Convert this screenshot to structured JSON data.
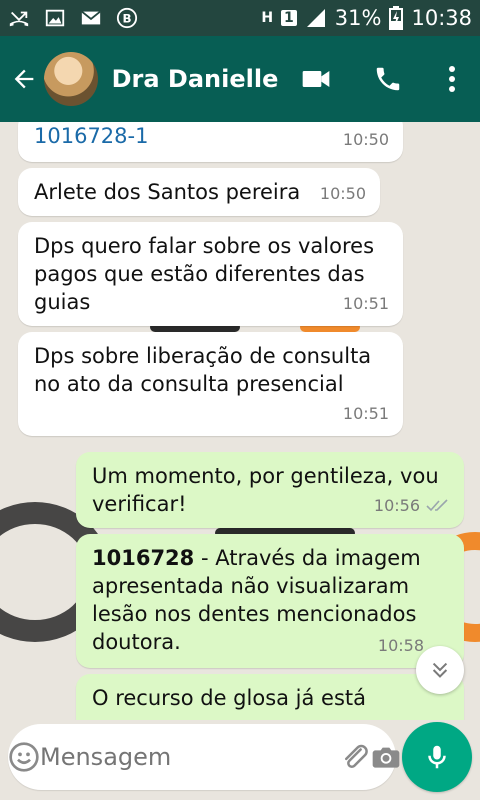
{
  "status_bar": {
    "network": "H",
    "sim": "1",
    "battery": "31%",
    "time": "10:38"
  },
  "header": {
    "contact_name": "Dra Danielle…",
    "icons": [
      "back-arrow-icon",
      "video-call-icon",
      "phone-call-icon",
      "more-options-icon"
    ]
  },
  "messages": [
    {
      "direction": "incoming",
      "text": "1016728-1",
      "time": "10:50",
      "is_link": true
    },
    {
      "direction": "incoming",
      "text": "Arlete dos Santos pereira",
      "time": "10:50"
    },
    {
      "direction": "incoming",
      "text": "Dps quero falar sobre os valores pagos que estão diferentes das guias",
      "time": "10:51"
    },
    {
      "direction": "incoming",
      "text": "Dps sobre liberação de consulta no ato da consulta presencial",
      "time": "10:51"
    },
    {
      "direction": "outgoing",
      "text": "Um momento, por gentileza, vou verificar!",
      "time": "10:56",
      "status": "read"
    },
    {
      "direction": "outgoing",
      "bold_prefix": "1016728",
      "text": " - Através da imagem apresentada não visualizaram lesão nos dentes mencionados doutora.",
      "time": "10:58",
      "status": "read"
    },
    {
      "direction": "outgoing",
      "text": "O recurso de glosa já está",
      "partial": true
    }
  ],
  "composer": {
    "placeholder": "Mensagem"
  },
  "colors": {
    "header": "#075e54",
    "status_bar": "#23463f",
    "outgoing_bubble": "#dcf8c6",
    "incoming_bubble": "#ffffff",
    "mic_button": "#00a884",
    "link": "#1a6aa8"
  }
}
